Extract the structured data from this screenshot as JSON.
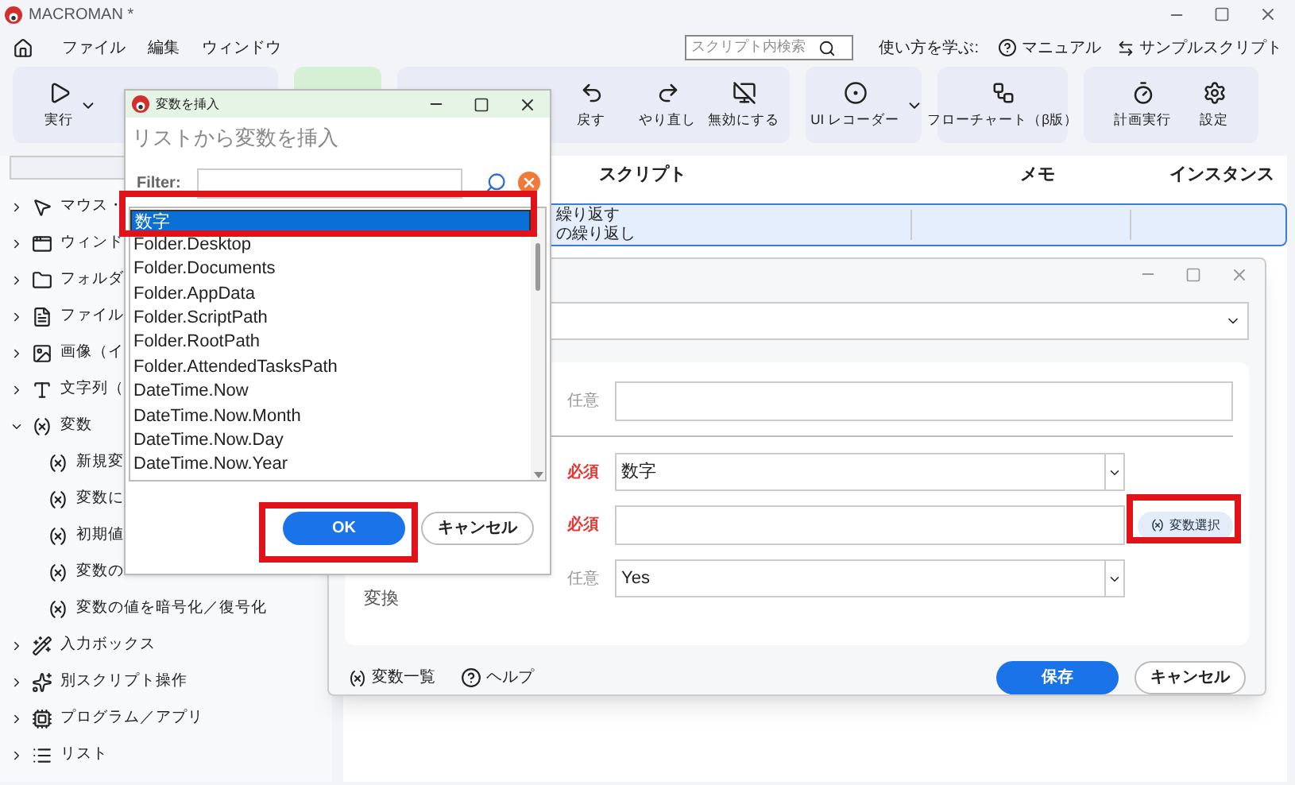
{
  "window": {
    "title": "MACROMAN *"
  },
  "menu": [
    "ファイル",
    "編集",
    "ウィンドウ"
  ],
  "search": {
    "placeholder": "スクリプト内検索"
  },
  "help": {
    "label": "使い方を学ぶ:",
    "links": [
      "マニュアル",
      "サンプルスクリプト"
    ]
  },
  "toolbar": {
    "run": "実行",
    "edit": [
      "戻す",
      "やり直し",
      "無効にする"
    ],
    "recorder": "UI レコーダー",
    "flowchart": "フローチャート（β版）",
    "tools": [
      "計画実行",
      "設定"
    ]
  },
  "sidebar": {
    "items": [
      {
        "label": "マウス・",
        "expanded": false
      },
      {
        "label": "ウィンド",
        "expanded": false
      },
      {
        "label": "フォルダ",
        "expanded": false
      },
      {
        "label": "ファイル",
        "expanded": false
      },
      {
        "label": "画像（イ",
        "expanded": false
      },
      {
        "label": "文字列（",
        "expanded": false
      },
      {
        "label": "変数",
        "expanded": true,
        "children": [
          {
            "label": "新規変"
          },
          {
            "label": "変数に"
          },
          {
            "label": "初期値"
          },
          {
            "label": "変数の"
          },
          {
            "label": "変数の値を暗号化／復号化"
          }
        ]
      },
      {
        "label": "入力ボックス",
        "expanded": false
      },
      {
        "label": "別スクリプト操作",
        "expanded": false
      },
      {
        "label": "プログラム／アプリ",
        "expanded": false
      },
      {
        "label": "リスト",
        "expanded": false
      }
    ]
  },
  "table": {
    "columns": [
      "スクリプト",
      "メモ",
      "インスタンス"
    ],
    "rows": [
      {
        "lines": [
          "繰り返す",
          "の繰り返し"
        ],
        "selected": true
      }
    ]
  },
  "editor": {
    "fields": [
      {
        "kind": "select"
      },
      {
        "kind": "input",
        "required": false,
        "tag": "任意"
      },
      {
        "kind": "select",
        "required": true,
        "tag": "必須",
        "value": "数字"
      },
      {
        "kind": "input",
        "required": true,
        "tag": "必須",
        "button": "変数選択"
      },
      {
        "kind": "select",
        "required": false,
        "tag": "任意",
        "value": "Yes",
        "side_label": "変換"
      }
    ],
    "links": [
      "変数一覧",
      "ヘルプ"
    ],
    "buttons": [
      "保存",
      "キャンセル"
    ]
  },
  "insert_dialog": {
    "title": "変数を挿入",
    "heading": "リストから変数を挿入",
    "filter_label": "Filter:",
    "items": [
      {
        "label": "数字",
        "selected": true
      },
      {
        "label": "Folder.Desktop",
        "selected": false
      },
      {
        "label": "Folder.Documents",
        "selected": false
      },
      {
        "label": "Folder.AppData",
        "selected": false
      },
      {
        "label": "Folder.ScriptPath",
        "selected": false
      },
      {
        "label": "Folder.RootPath",
        "selected": false
      },
      {
        "label": "Folder.AttendedTasksPath",
        "selected": false
      },
      {
        "label": "DateTime.Now",
        "selected": false
      },
      {
        "label": "DateTime.Now.Month",
        "selected": false
      },
      {
        "label": "DateTime.Now.Day",
        "selected": false
      },
      {
        "label": "DateTime.Now.Year",
        "selected": false
      }
    ],
    "buttons": [
      "OK",
      "キャンセル"
    ]
  }
}
